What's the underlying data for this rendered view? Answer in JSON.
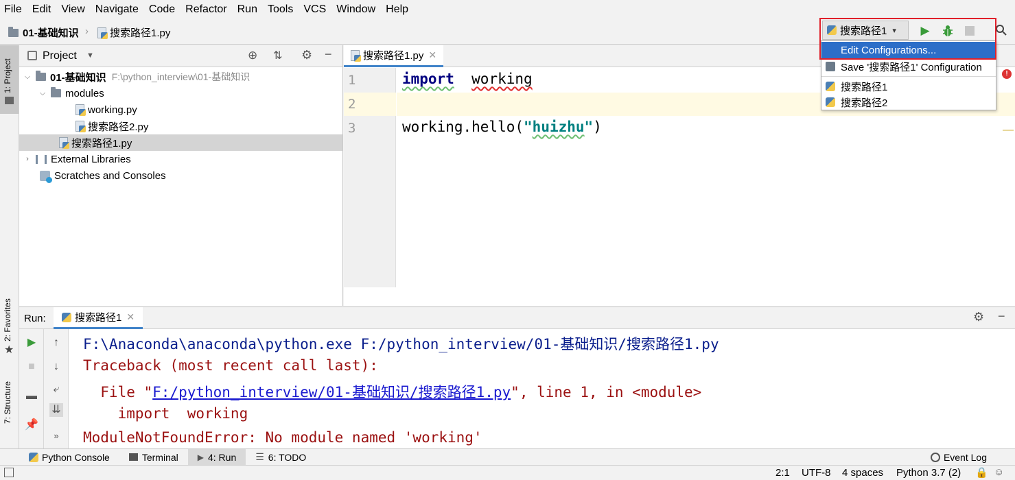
{
  "menubar": {
    "items": [
      "File",
      "Edit",
      "View",
      "Navigate",
      "Code",
      "Refactor",
      "Run",
      "Tools",
      "VCS",
      "Window",
      "Help"
    ]
  },
  "navbar": {
    "project": "01-基础知识",
    "file": "搜索路径1.py",
    "run_config": "搜索路径1"
  },
  "run_dropdown": {
    "edit_configurations": "Edit Configurations...",
    "save_configuration": "Save '搜索路径1' Configuration",
    "configs": [
      "搜索路径1",
      "搜索路径2"
    ]
  },
  "left_stripe": {
    "project_tab": "1: Project",
    "favorites_tab": "2: Favorites",
    "structure_tab": "7: Structure"
  },
  "project_panel": {
    "title": "Project",
    "tree": [
      {
        "label": "01-基础知识",
        "hint": "F:\\python_interview\\01-基础知识"
      },
      {
        "label": "modules"
      },
      {
        "label": "working.py"
      },
      {
        "label": "搜索路径2.py"
      },
      {
        "label": "搜索路径1.py"
      },
      {
        "label": "External Libraries"
      },
      {
        "label": "Scratches and Consoles"
      }
    ]
  },
  "editor": {
    "tab": "搜索路径1.py",
    "line_numbers": [
      "1",
      "2",
      "3"
    ],
    "line1": {
      "keyword": "import",
      "rest": "working"
    },
    "line3": {
      "pre": "working.hello(",
      "quote_open": "\"",
      "string": "huizhu",
      "quote_close": "\"",
      "post": ")"
    }
  },
  "run_panel": {
    "label": "Run:",
    "tab": "搜索路径1",
    "console": {
      "cmd": "F:\\Anaconda\\anaconda\\python.exe F:/python_interview/01-基础知识/搜索路径1.py",
      "traceback": "Traceback (most recent call last):",
      "file_prefix": "  File \"",
      "file_link": "F:/python_interview/01-基础知识/搜索路径1.py",
      "file_suffix": "\", line 1, in <module>",
      "import_line": "    import  working",
      "error": "ModuleNotFoundError: No module named 'working'"
    }
  },
  "bottom_tabs": {
    "python_console": "Python Console",
    "terminal": "Terminal",
    "run": "4: Run",
    "todo": "6: TODO",
    "event_log": "Event Log"
  },
  "statusbar": {
    "position": "2:1",
    "encoding": "UTF-8",
    "indent": "4 spaces",
    "interpreter": "Python 3.7 (2)"
  }
}
